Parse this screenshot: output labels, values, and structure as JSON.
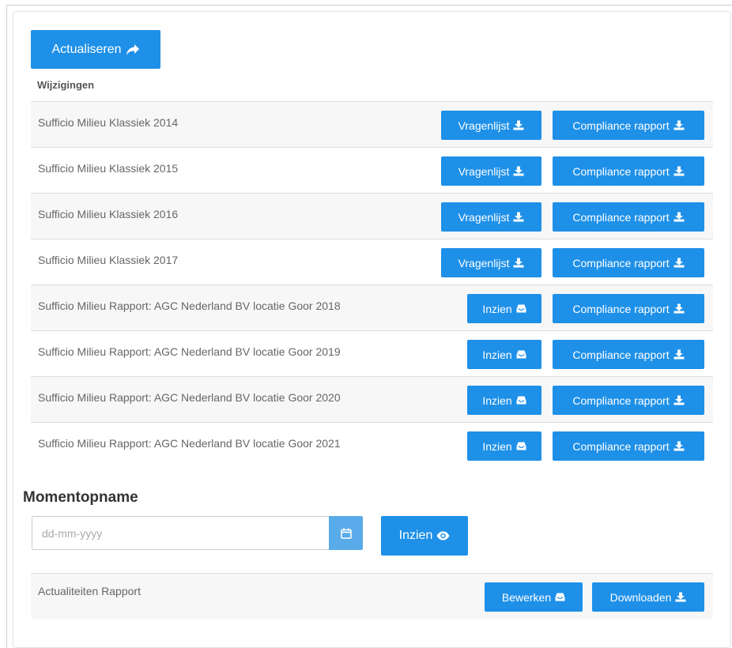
{
  "toolbar": {
    "refresh_label": "Actualiseren"
  },
  "changes": {
    "heading": "Wijzigingen",
    "rows": [
      {
        "title": "Sufficio Milieu Klassiek 2014",
        "primary_label": "Vragenlijst",
        "primary_icon": "download-icon",
        "secondary_label": "Compliance rapport"
      },
      {
        "title": "Sufficio Milieu Klassiek 2015",
        "primary_label": "Vragenlijst",
        "primary_icon": "download-icon",
        "secondary_label": "Compliance rapport"
      },
      {
        "title": "Sufficio Milieu Klassiek 2016",
        "primary_label": "Vragenlijst",
        "primary_icon": "download-icon",
        "secondary_label": "Compliance rapport"
      },
      {
        "title": "Sufficio Milieu Klassiek 2017",
        "primary_label": "Vragenlijst",
        "primary_icon": "download-icon",
        "secondary_label": "Compliance rapport"
      },
      {
        "title": "Sufficio Milieu Rapport: AGC Nederland BV locatie Goor 2018",
        "primary_label": "Inzien",
        "primary_icon": "inbox-icon",
        "secondary_label": "Compliance rapport"
      },
      {
        "title": "Sufficio Milieu Rapport: AGC Nederland BV locatie Goor 2019",
        "primary_label": "Inzien",
        "primary_icon": "inbox-icon",
        "secondary_label": "Compliance rapport"
      },
      {
        "title": "Sufficio Milieu Rapport: AGC Nederland BV locatie Goor 2020",
        "primary_label": "Inzien",
        "primary_icon": "inbox-icon",
        "secondary_label": "Compliance rapport"
      },
      {
        "title": "Sufficio Milieu Rapport: AGC Nederland BV locatie Goor 2021",
        "primary_label": "Inzien",
        "primary_icon": "inbox-icon",
        "secondary_label": "Compliance rapport"
      }
    ]
  },
  "snapshot": {
    "heading": "Momentopname",
    "date_placeholder": "dd-mm-yyyy",
    "view_label": "Inzien"
  },
  "report": {
    "title": "Actualiteiten Rapport",
    "edit_label": "Bewerken",
    "download_label": "Downloaden"
  },
  "colors": {
    "primary": "#1e90e8",
    "calendar_button": "#5aabe9",
    "row_stripe": "#f7f7f7"
  }
}
